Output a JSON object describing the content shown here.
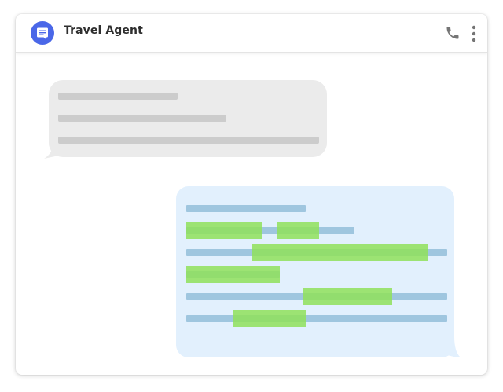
{
  "app": {
    "title": "Travel Agent",
    "avatar_icon": "message-icon",
    "accent_color": "#4a67e8"
  },
  "header_actions": [
    {
      "name": "phone-icon",
      "type": "button"
    },
    {
      "name": "more-vert-icon",
      "type": "button"
    }
  ],
  "conversation": {
    "incoming_message": {
      "redacted_lines": 3,
      "bubble_color": "#ebebeb"
    },
    "outgoing_message": {
      "redacted_lines": 6,
      "bubble_color": "#e2f0fd",
      "highlight_color": "#8fe05a",
      "highlight_count": 6
    }
  }
}
